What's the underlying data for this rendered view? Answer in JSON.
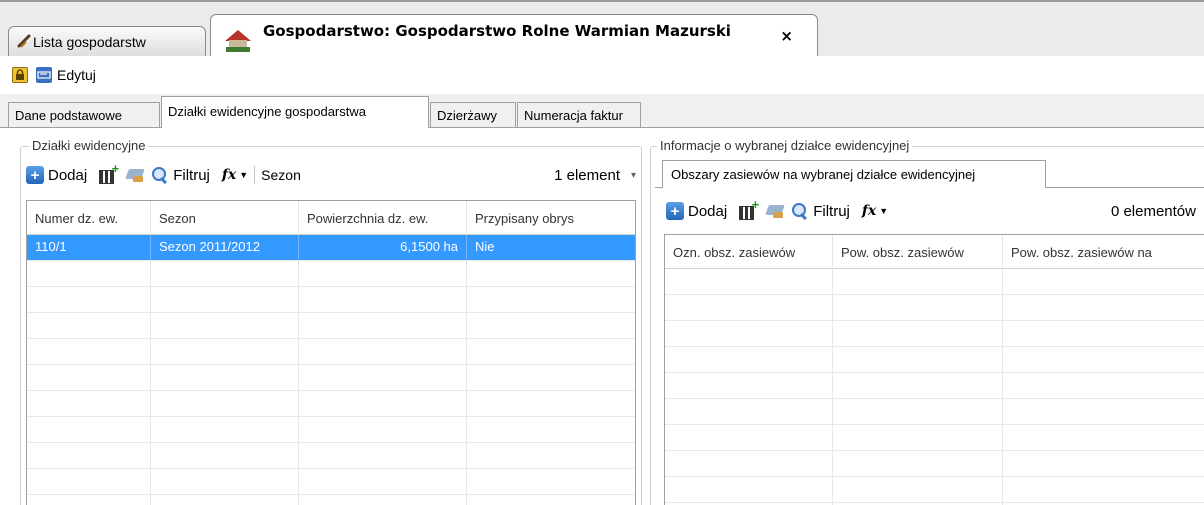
{
  "doc_tabs": {
    "list_label": "Lista gospodarstw",
    "farm_label": "Gospodarstwo: Gospodarstwo Rolne Warmian Mazurski",
    "close_glyph": "×"
  },
  "actionbar": {
    "edit_label": "Edytuj"
  },
  "section_tabs": [
    "Dane podstawowe",
    "Działki ewidencyjne gospodarstwa",
    "Dzierżawy",
    "Numeracja faktur"
  ],
  "left": {
    "group_title": "Działki ewidencyjne",
    "toolbar": {
      "add_label": "Dodaj",
      "filter_label": "Filtruj",
      "fx_label": "fx",
      "season_label": "Sezon",
      "count_label": "1 element"
    },
    "columns": [
      "Numer dz. ew.",
      "Sezon",
      "Powierzchnia dz. ew.",
      "Przypisany obrys"
    ],
    "rows": [
      [
        "110/1",
        "Sezon 2011/2012",
        "6,1500 ha",
        "Nie"
      ]
    ]
  },
  "right": {
    "group_title": "Informacje o wybranej działce ewidencyjnej",
    "inner_tab": "Obszary zasiewów na wybranej działce ewidencyjnej",
    "toolbar": {
      "add_label": "Dodaj",
      "filter_label": "Filtruj",
      "fx_label": "fx",
      "count_label": "0 elementów"
    },
    "columns": [
      "Ozn. obsz. zasiewów",
      "Pow. obsz. zasiewów",
      "Pow. obsz. zasiewów na"
    ]
  },
  "colors": {
    "selection": "#3399ff",
    "add_icon": "#2f7fd4"
  }
}
